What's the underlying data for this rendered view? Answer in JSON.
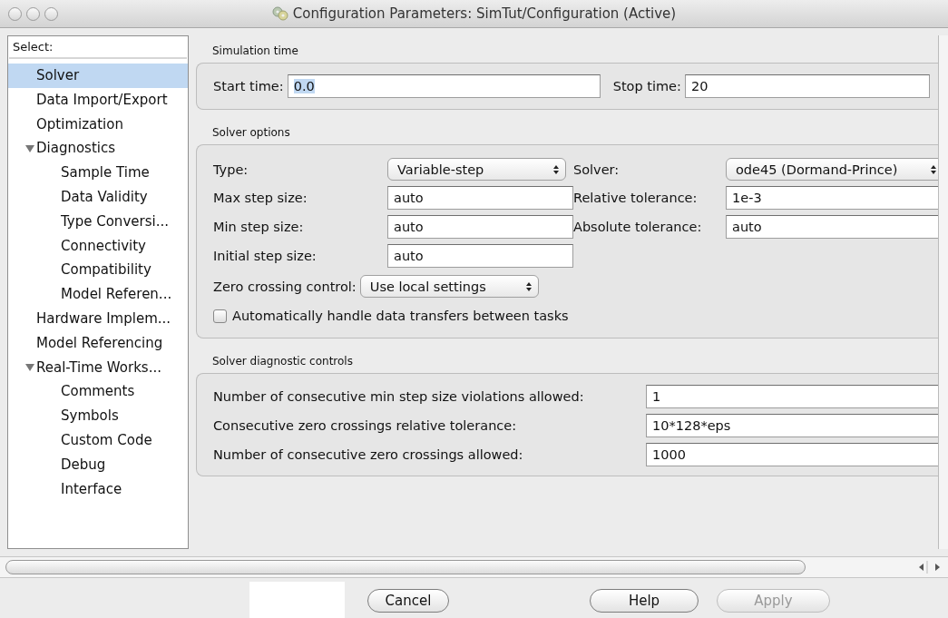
{
  "window": {
    "title": "Configuration Parameters: SimTut/Configuration (Active)"
  },
  "sidebar": {
    "header": "Select:",
    "items": [
      {
        "label": "Solver",
        "selected": true
      },
      {
        "label": "Data Import/Export",
        "selected": false
      },
      {
        "label": "Optimization",
        "selected": false
      },
      {
        "label": "Diagnostics",
        "selected": false,
        "expanded": true,
        "children": [
          {
            "label": "Sample Time",
            "selected": false
          },
          {
            "label": "Data Validity",
            "selected": false
          },
          {
            "label": "Type Conversi...",
            "selected": false
          },
          {
            "label": "Connectivity",
            "selected": false
          },
          {
            "label": "Compatibility",
            "selected": false
          },
          {
            "label": "Model Referen...",
            "selected": false
          }
        ]
      },
      {
        "label": "Hardware Implem...",
        "selected": false
      },
      {
        "label": "Model Referencing",
        "selected": false
      },
      {
        "label": "Real-Time Works...",
        "selected": false,
        "expanded": true,
        "children": [
          {
            "label": "Comments",
            "selected": false
          },
          {
            "label": "Symbols",
            "selected": false
          },
          {
            "label": "Custom Code",
            "selected": false
          },
          {
            "label": "Debug",
            "selected": false
          },
          {
            "label": "Interface",
            "selected": false
          }
        ]
      }
    ]
  },
  "simulation_time": {
    "title": "Simulation time",
    "start_time": {
      "label": "Start time:",
      "value": "0.0",
      "highlighted": true
    },
    "stop_time": {
      "label": "Stop time:",
      "value": "20",
      "highlighted": false
    }
  },
  "solver_options": {
    "title": "Solver options",
    "type": {
      "label": "Type:",
      "value": "Variable-step"
    },
    "solver": {
      "label": "Solver:",
      "value": "ode45 (Dormand-Prince)"
    },
    "max_step_size": {
      "label": "Max step size:",
      "value": "auto"
    },
    "relative_tolerance": {
      "label": "Relative tolerance:",
      "value": "1e-3"
    },
    "min_step_size": {
      "label": "Min step size:",
      "value": "auto"
    },
    "absolute_tolerance": {
      "label": "Absolute tolerance:",
      "value": "auto"
    },
    "initial_step_size": {
      "label": "Initial step size:",
      "value": "auto"
    },
    "zero_crossing_control": {
      "label": "Zero crossing control:",
      "value": "Use local settings"
    },
    "auto_data_transfer": {
      "label": "Automatically handle data transfers between tasks",
      "checked": false
    }
  },
  "diagnostic_controls": {
    "title": "Solver diagnostic controls",
    "fields": [
      {
        "label": "Number of consecutive min step size violations allowed:",
        "value": "1"
      },
      {
        "label": "Consecutive zero crossings relative tolerance:",
        "value": "10*128*eps"
      },
      {
        "label": "Number of consecutive zero crossings allowed:",
        "value": "1000"
      }
    ]
  },
  "buttons": [
    {
      "label": "Cancel",
      "disabled": false
    },
    {
      "label": "Help",
      "disabled": false
    },
    {
      "label": "Apply",
      "disabled": true
    }
  ]
}
